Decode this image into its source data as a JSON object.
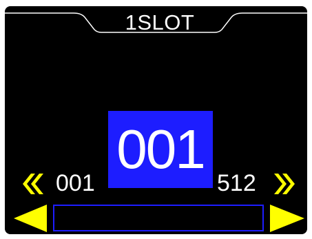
{
  "header": {
    "title": "1SLOT"
  },
  "selector": {
    "value": "001",
    "range_min": "001",
    "range_max": "512",
    "slider_fill_fraction": 0
  },
  "icons": {
    "fast_back": "double-chevron-left-icon",
    "fast_forward": "double-chevron-right-icon",
    "back": "triangle-left-icon",
    "forward": "triangle-right-icon"
  },
  "colors": {
    "background": "#000000",
    "accent_blue": "#1d1dff",
    "arrow_yellow": "#ffff00",
    "text": "#ffffff"
  }
}
